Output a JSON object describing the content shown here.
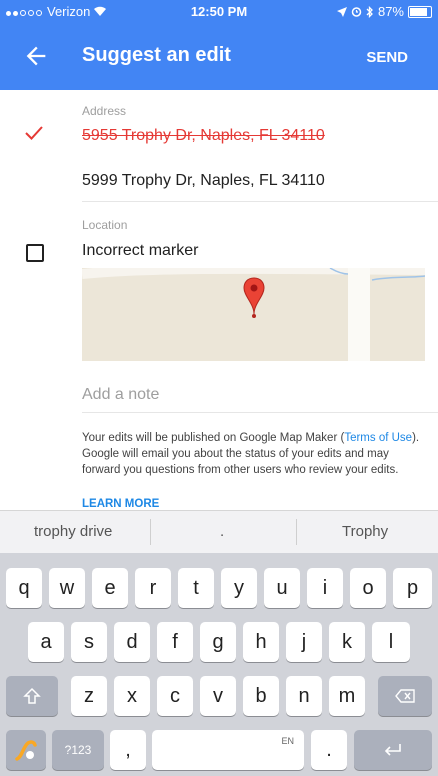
{
  "status": {
    "carrier": "Verizon",
    "time": "12:50 PM",
    "battery": "87%"
  },
  "appbar": {
    "title": "Suggest an edit",
    "send": "SEND"
  },
  "address": {
    "label": "Address",
    "old_value": "5955 Trophy Dr, Naples, FL 34110",
    "new_value": "5999 Trophy Dr, Naples, FL 34110"
  },
  "location": {
    "label": "Location",
    "checkbox_label": "Incorrect marker",
    "checked": false
  },
  "note": {
    "placeholder": "Add a note"
  },
  "disclaimer": {
    "part1": "Your edits will be published on Google Map Maker (",
    "link": "Terms of Use",
    "part2": "). Google will email you about the status of your edits and may forward you questions from other users who review your edits.",
    "learn_more": "LEARN MORE"
  },
  "suggestions": [
    "trophy drive",
    ".",
    "Trophy"
  ],
  "keyboard": {
    "row1": [
      "q",
      "w",
      "e",
      "r",
      "t",
      "y",
      "u",
      "i",
      "o",
      "p"
    ],
    "row2": [
      "a",
      "s",
      "d",
      "f",
      "g",
      "h",
      "j",
      "k",
      "l"
    ],
    "row3": [
      "z",
      "x",
      "c",
      "v",
      "b",
      "n",
      "m"
    ],
    "symbols_key": "?123",
    "comma": ",",
    "space_label": "EN",
    "period": "."
  },
  "colors": {
    "primary": "#4285f4",
    "error": "#e53935",
    "link": "#1e88e5",
    "pin": "#ea4335"
  }
}
